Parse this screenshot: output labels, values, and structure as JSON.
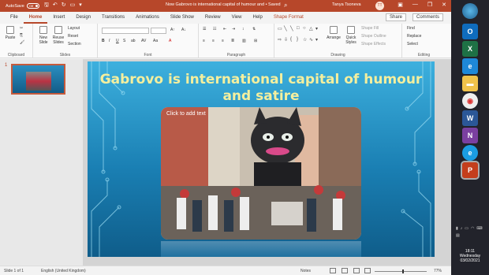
{
  "titlebar": {
    "autosave_label": "AutoSave",
    "autosave_state": "Off",
    "doc_title": "Now Gabrovo is international capital of humour and  •  Saved",
    "user_name": "Tanya Tsoneva",
    "user_initials": "TT"
  },
  "tabs": [
    "File",
    "Home",
    "Insert",
    "Design",
    "Transitions",
    "Animations",
    "Slide Show",
    "Review",
    "View",
    "Help"
  ],
  "tab_extra": "Shape Format",
  "share_label": "Share",
  "comments_label": "Comments",
  "ribbon": {
    "clipboard": {
      "paste": "Paste",
      "label": "Clipboard"
    },
    "slides": {
      "new_slide": "New Slide",
      "reuse_slides": "Reuse Slides",
      "layout": "Layout",
      "reset": "Reset",
      "section": "Section",
      "label": "Slides"
    },
    "font_label": "Font",
    "paragraph_label": "Paragraph",
    "drawing": {
      "arrange": "Arrange",
      "quick_styles": "Quick Styles",
      "shape_fill": "Shape Fill",
      "shape_outline": "Shape Outline",
      "shape_effects": "Shape Effects",
      "label": "Drawing"
    },
    "editing": {
      "find": "Find",
      "replace": "Replace",
      "select": "Select",
      "label": "Editing"
    }
  },
  "thumbnail_number": "1",
  "slide": {
    "title": "Gabrovo is international capital of humour and satire",
    "placeholder": "Click to add text"
  },
  "statusbar": {
    "slide_info": "Slide 1 of 1",
    "language": "English (United Kingdom)",
    "notes": "Notes",
    "zoom": "77%"
  },
  "taskbar": {
    "time": "18:11",
    "day": "Wednesday",
    "date": "03/02/2021"
  }
}
